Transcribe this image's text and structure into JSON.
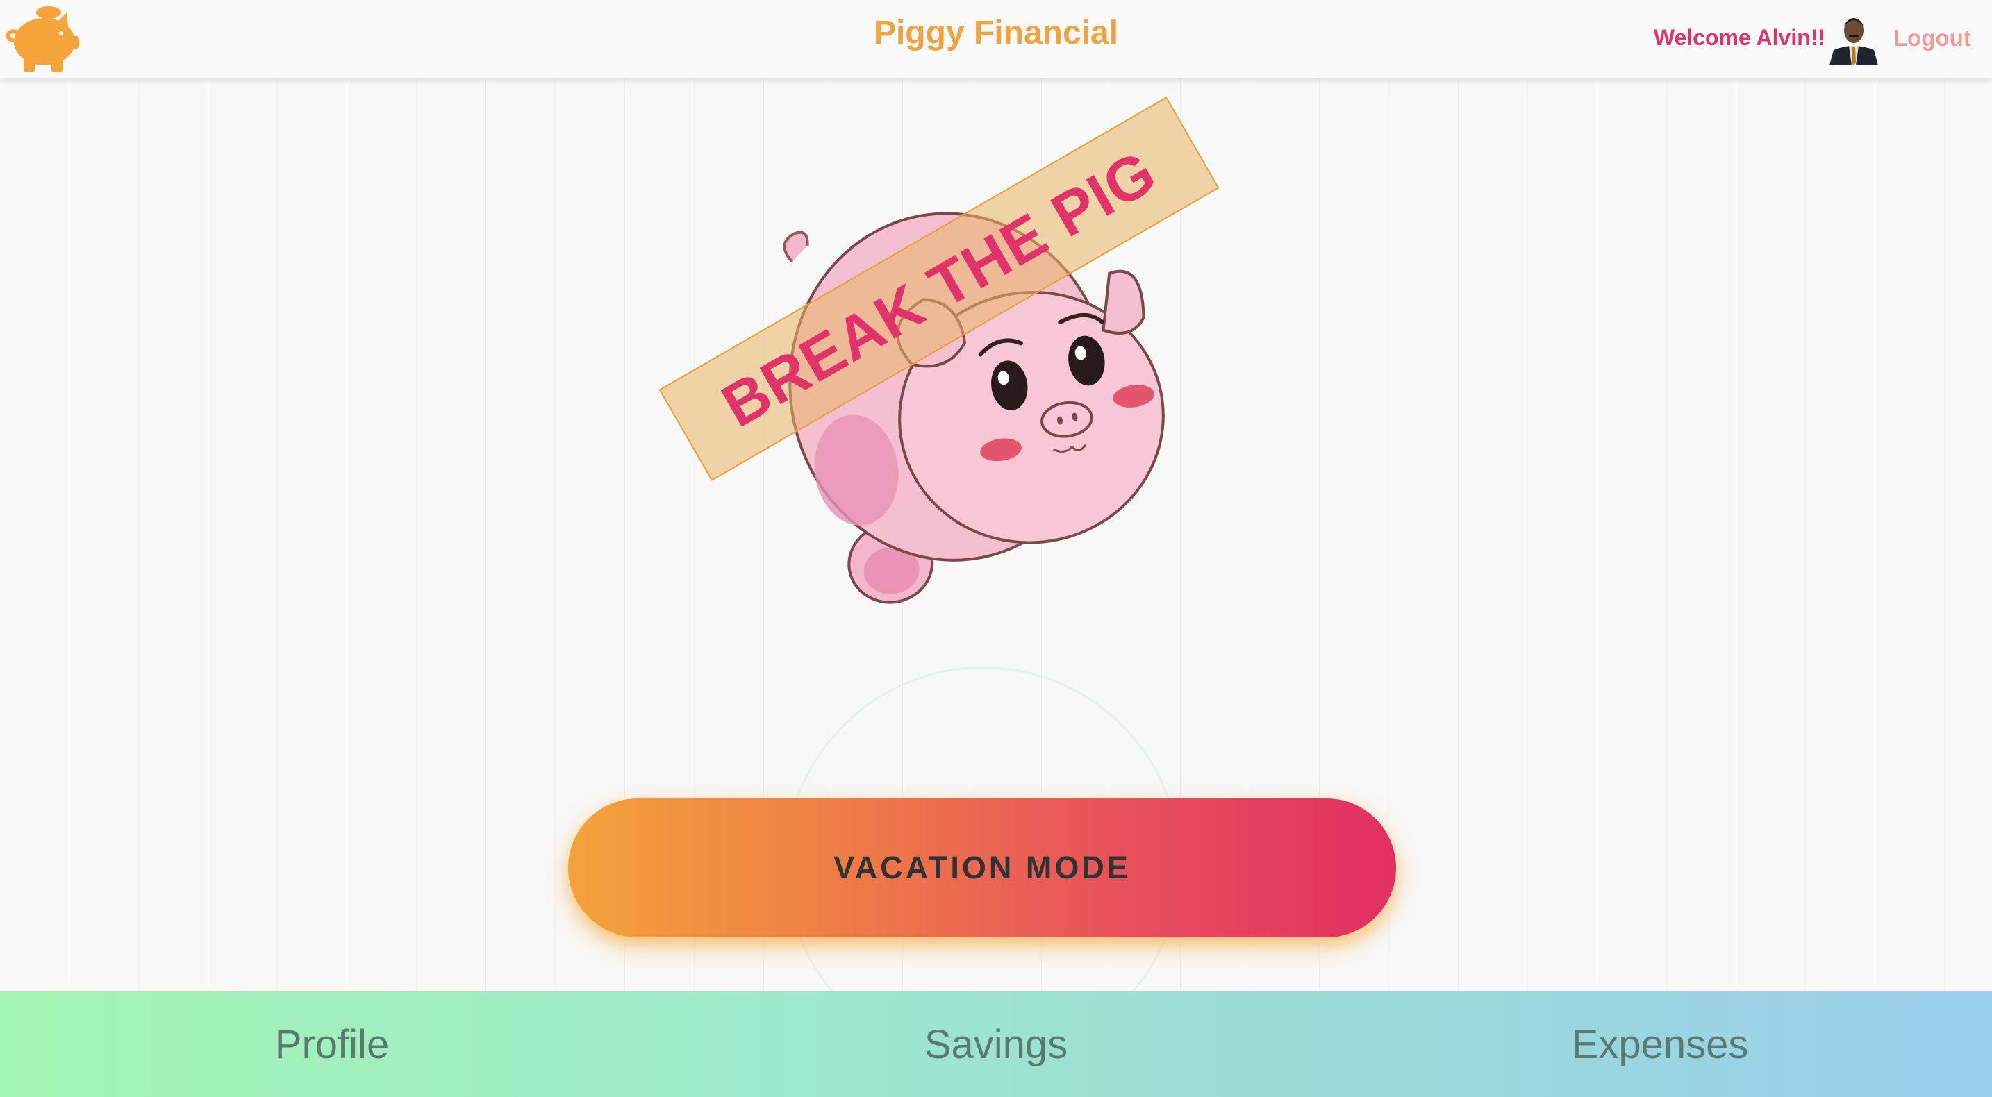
{
  "header": {
    "title": "Piggy Financial",
    "logo_icon": "piggy-bank-icon",
    "welcome_text": "Welcome Alvin!!",
    "logout_label": "Logout",
    "avatar": "user-avatar"
  },
  "main": {
    "pig_image": "piggy-bank-illustration",
    "banner_text": "BREAK THE PIG",
    "vacation_button_label": "VACATION MODE"
  },
  "bottom_nav": {
    "items": [
      {
        "label": "Profile"
      },
      {
        "label": "Savings"
      },
      {
        "label": "Expenses"
      }
    ]
  },
  "colors": {
    "brand_orange": "#f0a341",
    "brand_pink": "#e0336a",
    "logout_pink": "#f29b96"
  }
}
